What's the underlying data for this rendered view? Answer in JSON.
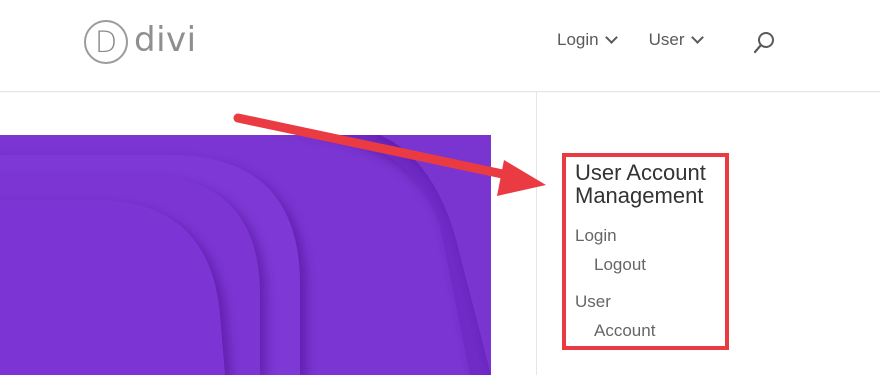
{
  "header": {
    "logo_letter": "D",
    "logo_text": "divi",
    "nav": [
      {
        "label": "Login"
      },
      {
        "label": "User"
      }
    ],
    "search_icon": "search-icon"
  },
  "sidebar_widget": {
    "title": "User Account Management",
    "items": [
      {
        "label": "Login",
        "children": [
          {
            "label": "Logout"
          }
        ]
      },
      {
        "label": "User",
        "children": [
          {
            "label": "Account"
          }
        ]
      }
    ]
  },
  "colors": {
    "hero_purple": "#7b35d3",
    "annotation_red": "#ea3b43"
  }
}
